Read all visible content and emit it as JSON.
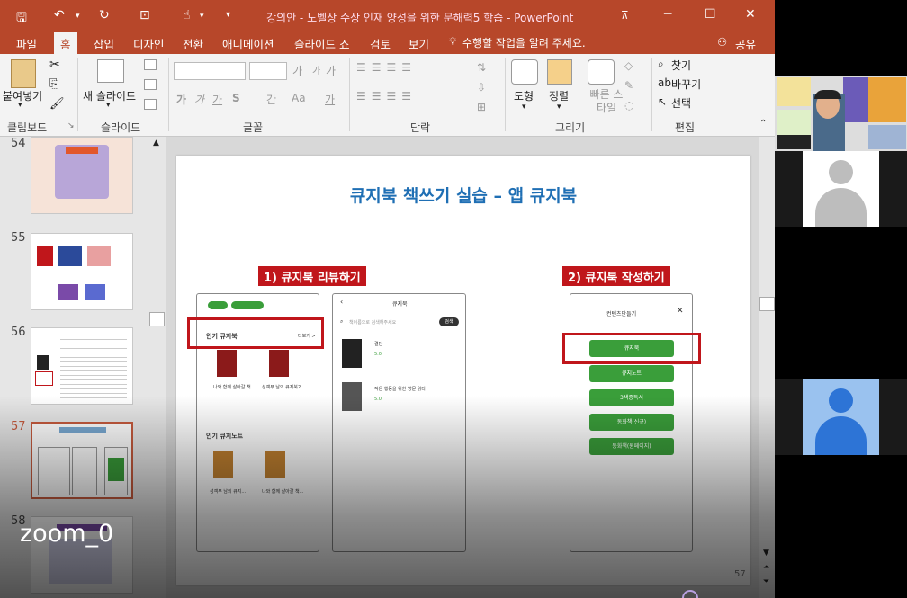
{
  "window": {
    "title": "강의안 - 노벨상 수상 인재 양성을 위한 문해력5 학습 - PowerPoint",
    "quick_access": [
      "save-icon",
      "undo-icon",
      "redo-icon",
      "present-icon",
      "touch-icon",
      "customize-icon"
    ]
  },
  "tabs": [
    {
      "label": "파일"
    },
    {
      "label": "홈"
    },
    {
      "label": "삽입"
    },
    {
      "label": "디자인"
    },
    {
      "label": "전환"
    },
    {
      "label": "애니메이션"
    },
    {
      "label": "슬라이드 쇼"
    },
    {
      "label": "검토"
    },
    {
      "label": "보기"
    }
  ],
  "tell_me": "수행할 작업을 알려 주세요.",
  "share_label": "공유",
  "ribbon": {
    "clipboard": {
      "paste": "붙여넣기",
      "group": "클립보드"
    },
    "slides": {
      "new_slide": "새 슬라이드",
      "group": "슬라이드"
    },
    "font": {
      "group": "글꼴",
      "bold": "가",
      "italic": "가",
      "underline": "가",
      "strike": "S",
      "spacing": "간",
      "case": "Aa",
      "color": "가",
      "grow": "가",
      "shrink": "가",
      "clear": "가"
    },
    "paragraph": {
      "group": "단락"
    },
    "drawing": {
      "shapes": "도형",
      "arrange": "정렬",
      "quick_styles": "빠른 스타일",
      "group": "그리기"
    },
    "editing": {
      "find": "찾기",
      "replace": "바꾸기",
      "select": "선택",
      "group": "편집"
    }
  },
  "thumbnails": [
    {
      "num": "54",
      "selected": false
    },
    {
      "num": "55",
      "selected": false
    },
    {
      "num": "56",
      "selected": false
    },
    {
      "num": "57",
      "selected": true
    },
    {
      "num": "58",
      "selected": false
    }
  ],
  "slide": {
    "title": "큐지북 책쓰기 실습 – 앱 큐지북",
    "label_left": "1) 큐지북 리뷰하기",
    "label_right": "2) 큐지북 작성하기",
    "page_number": "57",
    "phone1": {
      "popular_book": "인기 큐지북",
      "more": "더보기 >",
      "popular_note": "인기 큐지노트",
      "book1": "나와 함께 살아갈 책 ...",
      "book2": "성객무 남의 큐지북2",
      "note1": "성객무 남의 큐지...",
      "note2": "나와 함께 살아갈 책..."
    },
    "phone2": {
      "header": "큐지북",
      "search_placeholder": "책이름으로 검색해주세요",
      "search_btn": "검색",
      "item1": "결단",
      "item2": "작은 행동을 위한 방문 읽다",
      "rating": "5.0"
    },
    "phone3": {
      "header": "컨텐츠만들기",
      "buttons": [
        "큐지북",
        "큐지노트",
        "3색증독서",
        "동화책(신규)",
        "동화책(원페이지)"
      ]
    }
  },
  "zoom_label": "zoom_0"
}
